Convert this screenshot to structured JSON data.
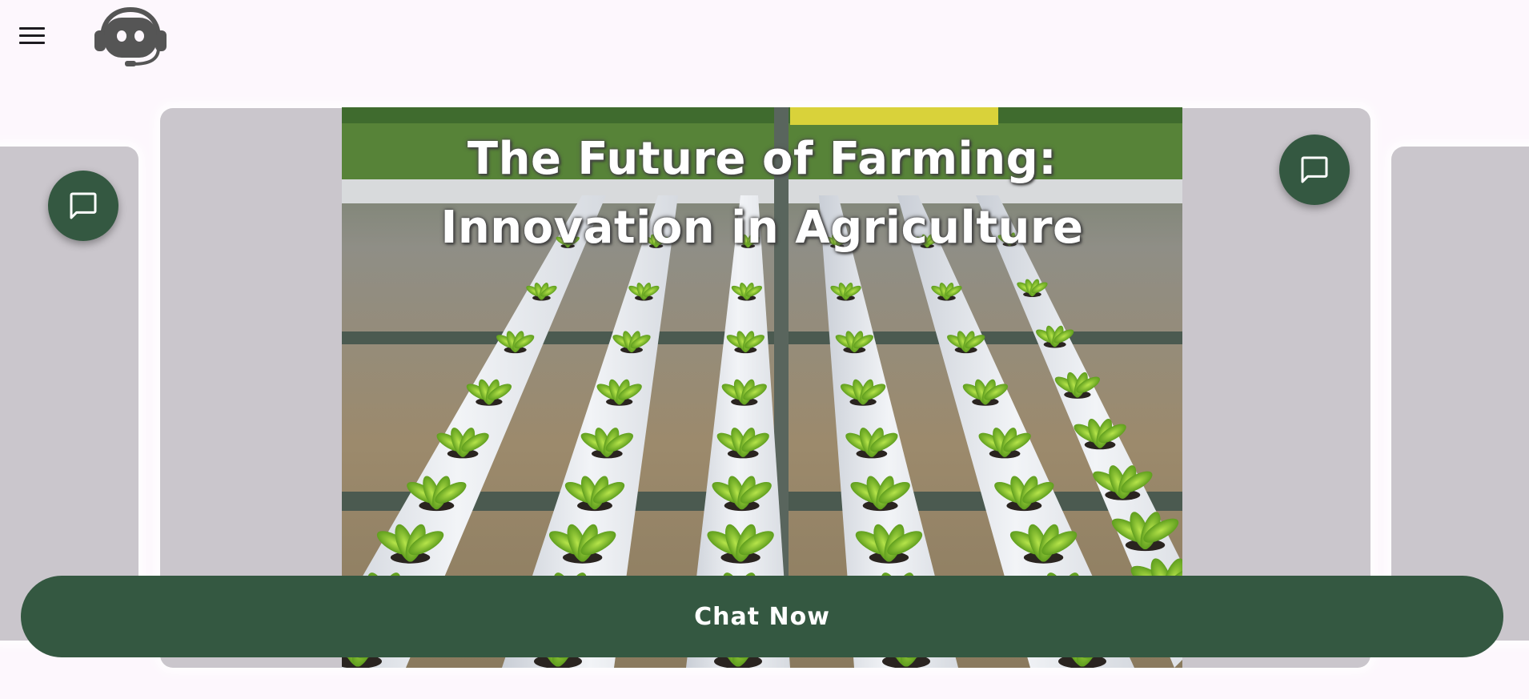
{
  "header": {
    "menu_icon": "hamburger-menu-icon",
    "logo_icon": "robot-headset-logo-icon"
  },
  "carousel": {
    "current_slide": {
      "title": "The Future of Farming: Innovation in Agriculture",
      "image": "hydroponic-lettuce-rows-photo"
    }
  },
  "chat_fab_icon": "chat-bubble-icon",
  "cta": {
    "chat_now_label": "Chat Now"
  },
  "colors": {
    "background": "#fdf7fd",
    "primary": "#345841",
    "card": "#cac6cc",
    "on_primary": "#ffffff"
  }
}
